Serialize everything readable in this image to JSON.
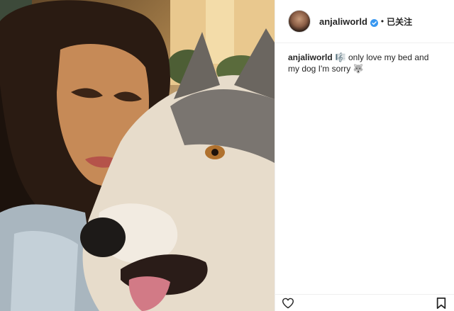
{
  "post": {
    "username": "anjaliworld",
    "separator": "•",
    "follow_label": "已关注",
    "caption": {
      "username": "anjaliworld",
      "emoji_1": "🎼",
      "text": "only love my bed and my dog I'm sorry",
      "emoji_2": "🐺"
    }
  },
  "icons": {
    "verified": "verified-badge-icon",
    "like": "heart-icon",
    "save": "bookmark-icon"
  },
  "colors": {
    "verified": "#3897f0",
    "text": "#262626",
    "border": "#efefef"
  }
}
